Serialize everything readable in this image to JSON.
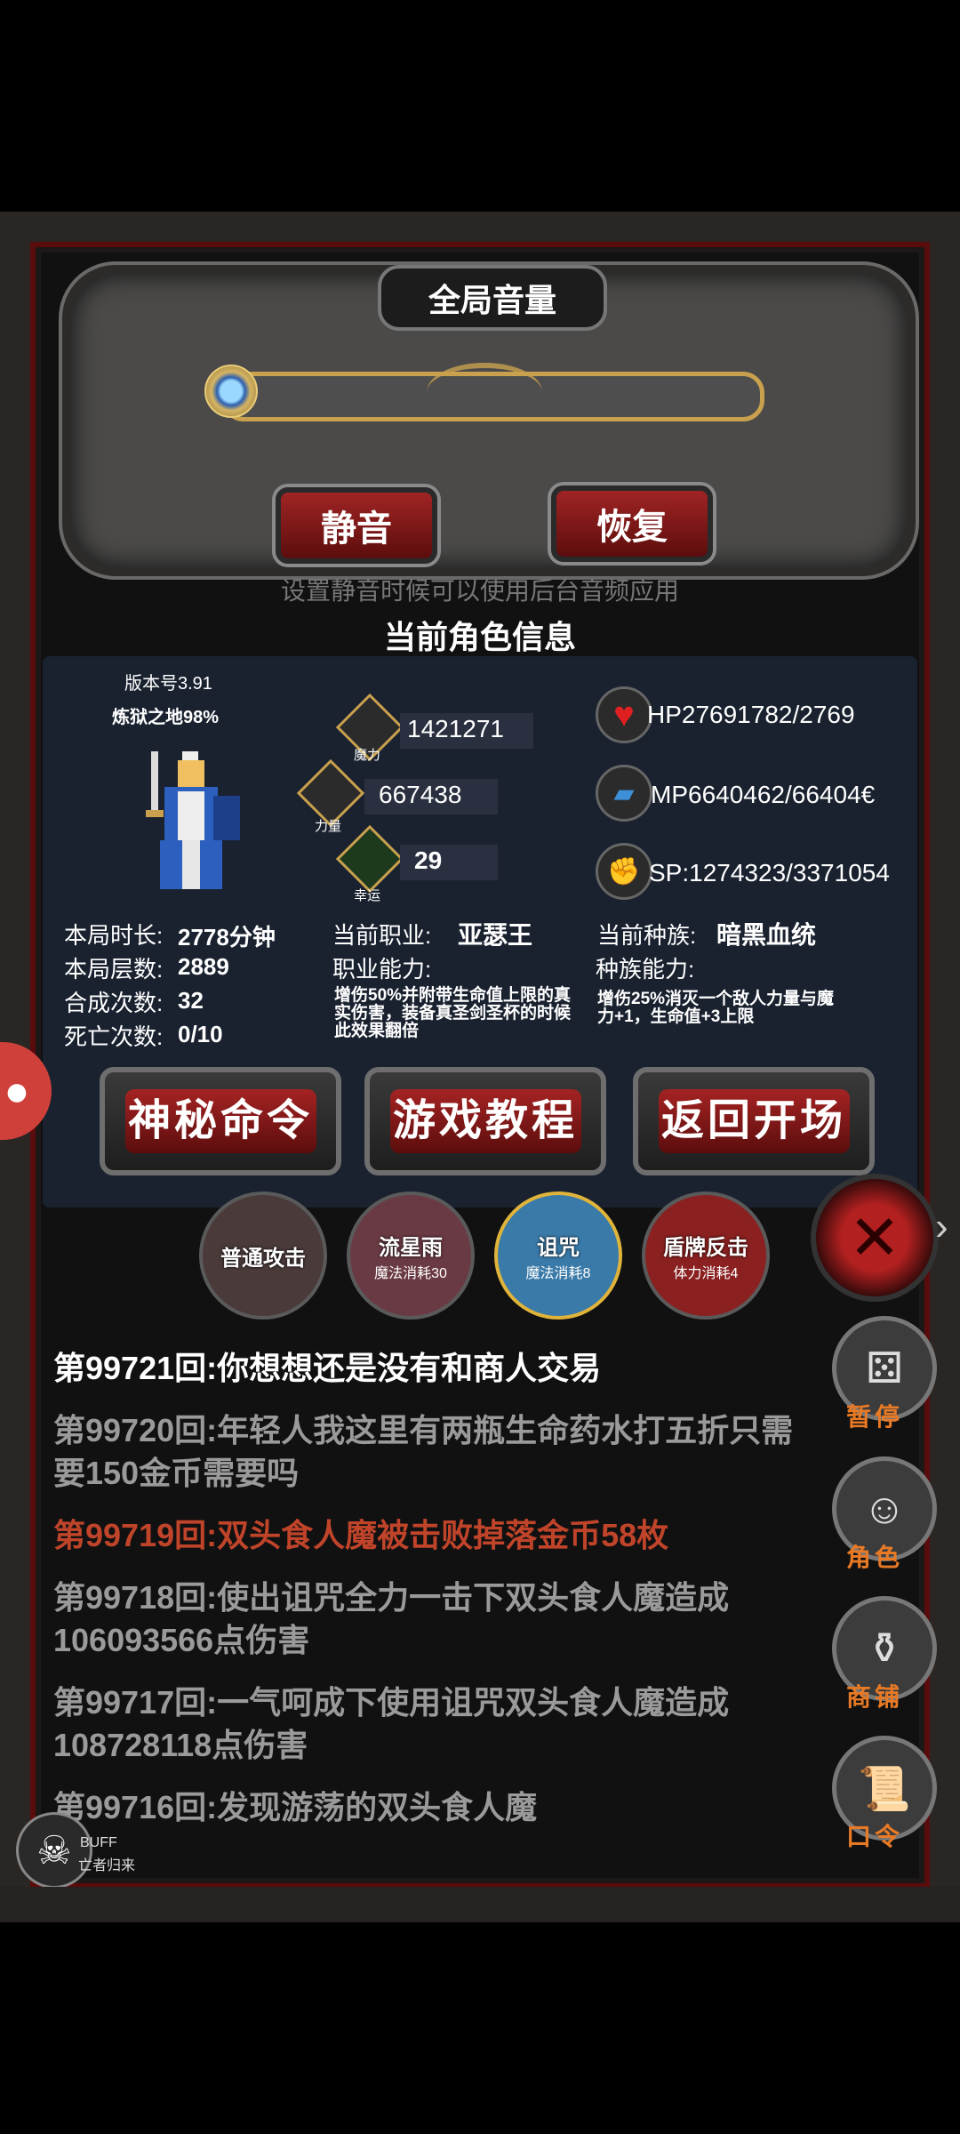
{
  "volume": {
    "title": "全局音量",
    "mute_label": "静音",
    "restore_label": "恢复",
    "note": "设置静音时候可以使用后台音频应用",
    "level_fraction": 0.0
  },
  "character": {
    "header": "当前角色信息",
    "version": "版本号3.91",
    "realm": "炼狱之地98%",
    "magic_value": "1421271",
    "magic_label": "魔力",
    "power_value": "667438",
    "power_label": "力量",
    "luck_value": "29",
    "luck_label": "幸运",
    "hp": "HP27691782/2769",
    "mp": "MP6640462/66404€",
    "sp": "SP:1274323/3371054",
    "duration_label": "本局时长:",
    "duration_value": "2778分钟",
    "floors_label": "本局层数:",
    "floors_value": "2889",
    "synth_label": "合成次数:",
    "synth_value": "32",
    "death_label": "死亡次数:",
    "death_value": "0/10",
    "class_label": "当前职业:",
    "class_value": "亚瑟王",
    "class_ability_label": "职业能力:",
    "class_ability_desc": "增伤50%并附带生命值上限的真实伤害，装备真圣剑圣杯的时候此效果翻倍",
    "race_label": "当前种族:",
    "race_value": "暗黑血统",
    "race_ability_label": "种族能力:",
    "race_ability_desc": "增伤25%消灭一个敌人力量与魔力+1，生命值+3上限"
  },
  "menu": {
    "secret_cmd": "神秘命令",
    "tutorial": "游戏教程",
    "return_start": "返回开场"
  },
  "skills": [
    {
      "name": "普通攻击",
      "cost": ""
    },
    {
      "name": "流星雨",
      "cost": "魔法消耗30"
    },
    {
      "name": "诅咒",
      "cost": "魔法消耗8"
    },
    {
      "name": "盾牌反击",
      "cost": "体力消耗4"
    }
  ],
  "log": [
    {
      "text": "第99721回:你想想还是没有和商人交易",
      "color": "#ffffff"
    },
    {
      "text": "第99720回:年轻人我这里有两瓶生命药水打五折只需要150金币需要吗",
      "color": "#9a9a9a"
    },
    {
      "text": "第99719回:双头食人魔被击败掉落金币58枚",
      "color": "#c0442a"
    },
    {
      "text": "第99718回:使出诅咒全力一击下双头食人魔造成106093566点伤害",
      "color": "#9a9a9a"
    },
    {
      "text": "第99717回:一气呵成下使用诅咒双头食人魔造成108728118点伤害",
      "color": "#9a9a9a"
    },
    {
      "text": "第99716回:发现游荡的双头食人魔",
      "color": "#9a9a9a"
    }
  ],
  "side_menu": {
    "pause": "暂停",
    "role": "角色",
    "shop": "商铺",
    "command": "口令"
  },
  "buff": {
    "label": "BUFF",
    "sub": "亡者归来"
  },
  "colors": {
    "accent_red": "#a52323",
    "gold": "#c9a14e",
    "log_highlight": "#c0442a",
    "side_label": "#e87a26"
  }
}
